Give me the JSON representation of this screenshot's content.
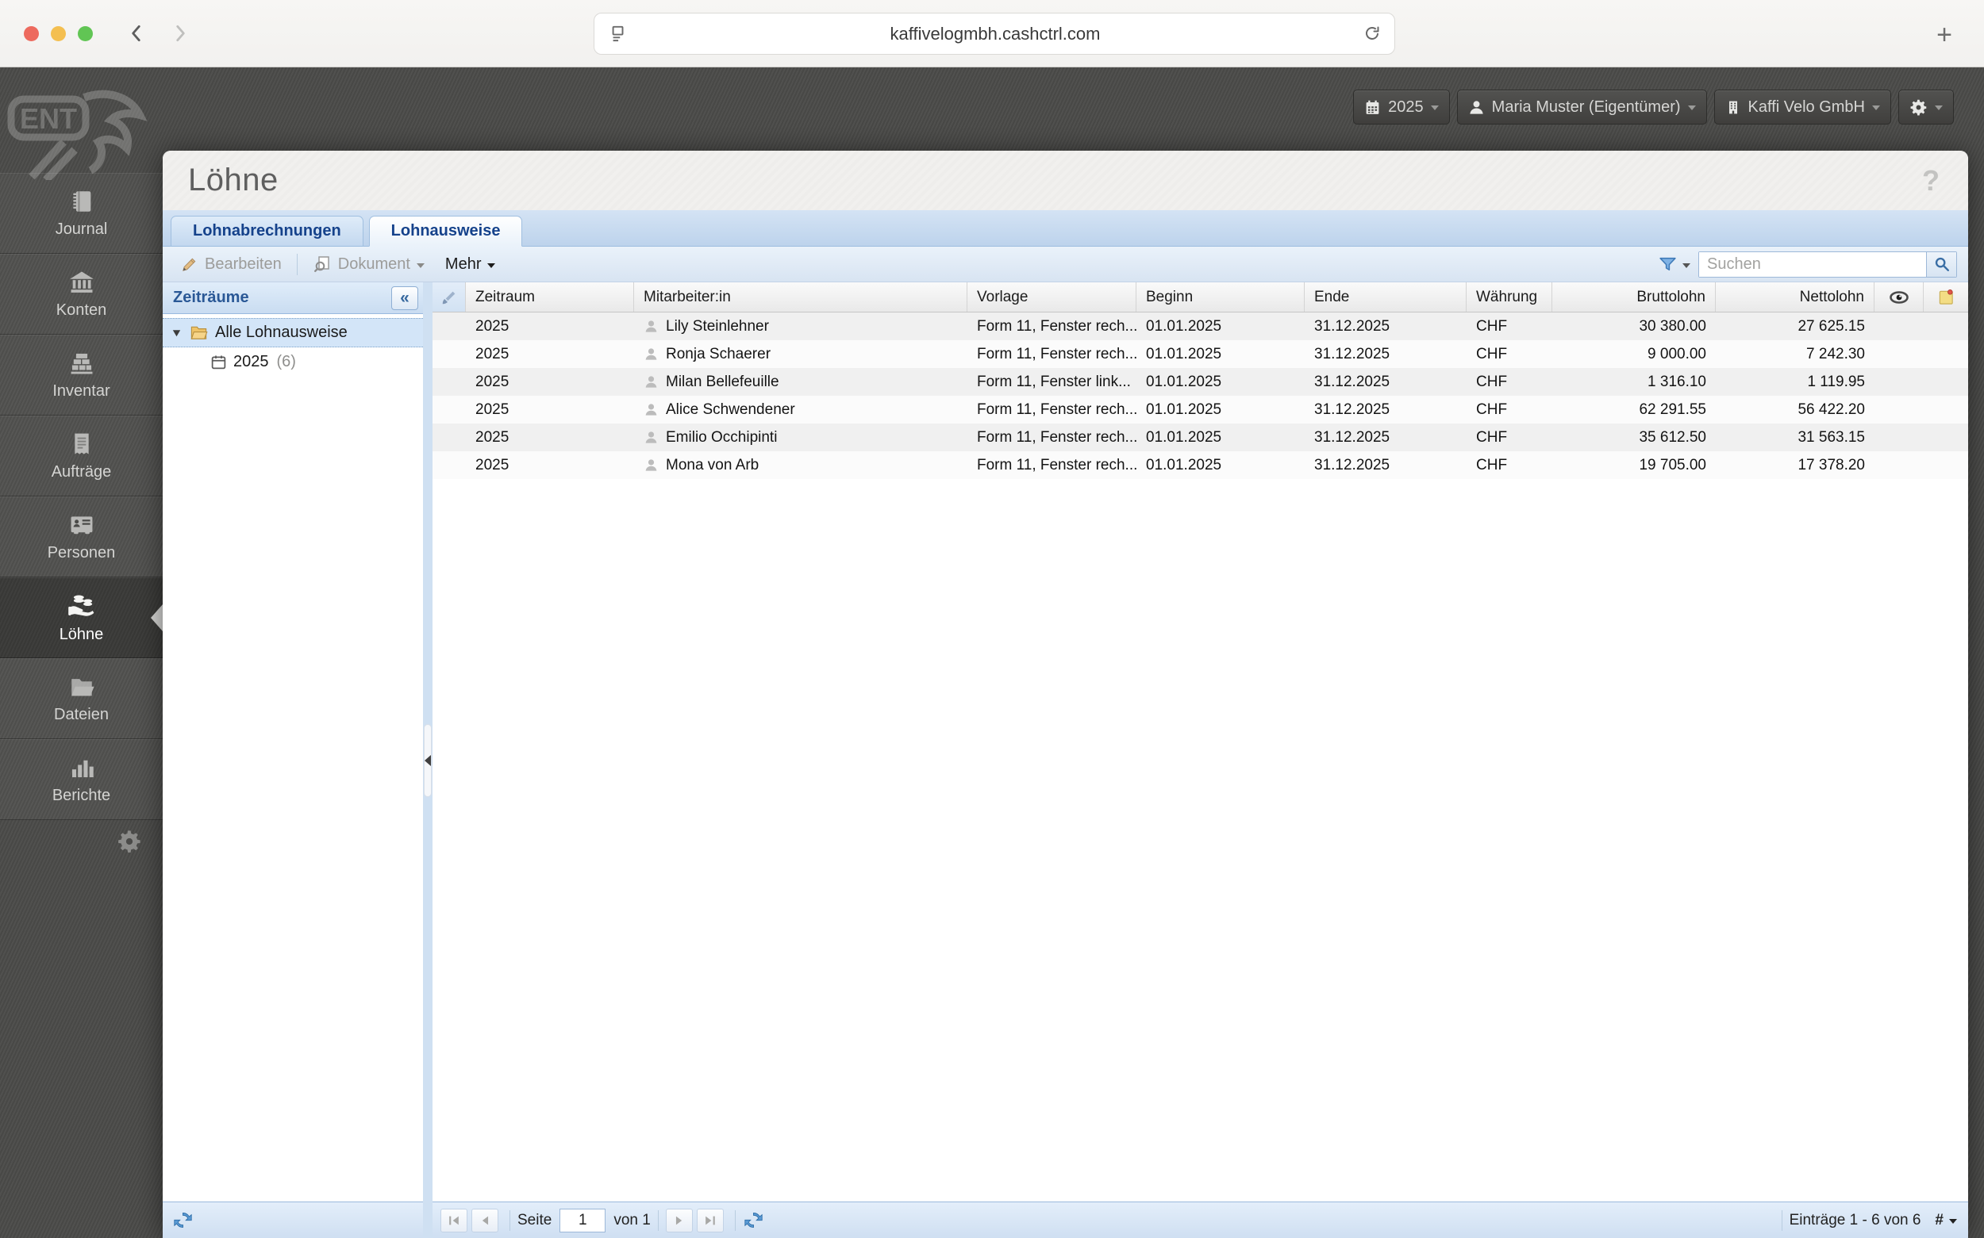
{
  "browser": {
    "url": "kaffivelogmbh.cashctrl.com"
  },
  "topbar": {
    "year": "2025",
    "user": "Maria Muster (Eigentümer)",
    "company": "Kaffi Velo GmbH"
  },
  "sidebar": {
    "logo": "ENT",
    "items": [
      {
        "label": "Journal"
      },
      {
        "label": "Konten"
      },
      {
        "label": "Inventar"
      },
      {
        "label": "Aufträge"
      },
      {
        "label": "Personen"
      },
      {
        "label": "Löhne",
        "active": true
      },
      {
        "label": "Dateien"
      },
      {
        "label": "Berichte"
      }
    ]
  },
  "page": {
    "title": "Löhne",
    "help_label": "?",
    "tabs": [
      {
        "label": "Lohnabrechnungen",
        "active": false
      },
      {
        "label": "Lohnausweise",
        "active": true
      }
    ],
    "toolbar": {
      "edit_label": "Bearbeiten",
      "document_label": "Dokument",
      "more_label": "Mehr",
      "search_placeholder": "Suchen"
    }
  },
  "tree": {
    "title": "Zeiträume",
    "collapse_glyph": "«",
    "root_label": "Alle Lohnausweise",
    "children": [
      {
        "label": "2025",
        "count": "(6)"
      }
    ]
  },
  "grid": {
    "columns": {
      "zeitraum": "Zeitraum",
      "mitarbeiter": "Mitarbeiter:in",
      "vorlage": "Vorlage",
      "beginn": "Beginn",
      "ende": "Ende",
      "waehrung": "Währung",
      "brutto": "Bruttolohn",
      "netto": "Nettolohn"
    },
    "rows": [
      {
        "zeitraum": "2025",
        "mitarbeiter": "Lily Steinlehner",
        "vorlage": "Form 11, Fenster rech...",
        "beginn": "01.01.2025",
        "ende": "31.12.2025",
        "waehrung": "CHF",
        "brutto": "30 380.00",
        "netto": "27 625.15"
      },
      {
        "zeitraum": "2025",
        "mitarbeiter": "Ronja Schaerer",
        "vorlage": "Form 11, Fenster rech...",
        "beginn": "01.01.2025",
        "ende": "31.12.2025",
        "waehrung": "CHF",
        "brutto": "9 000.00",
        "netto": "7 242.30"
      },
      {
        "zeitraum": "2025",
        "mitarbeiter": "Milan Bellefeuille",
        "vorlage": "Form 11, Fenster link...",
        "beginn": "01.01.2025",
        "ende": "31.12.2025",
        "waehrung": "CHF",
        "brutto": "1 316.10",
        "netto": "1 119.95"
      },
      {
        "zeitraum": "2025",
        "mitarbeiter": "Alice Schwendener",
        "vorlage": "Form 11, Fenster rech...",
        "beginn": "01.01.2025",
        "ende": "31.12.2025",
        "waehrung": "CHF",
        "brutto": "62 291.55",
        "netto": "56 422.20"
      },
      {
        "zeitraum": "2025",
        "mitarbeiter": "Emilio Occhipinti",
        "vorlage": "Form 11, Fenster rech...",
        "beginn": "01.01.2025",
        "ende": "31.12.2025",
        "waehrung": "CHF",
        "brutto": "35 612.50",
        "netto": "31 563.15"
      },
      {
        "zeitraum": "2025",
        "mitarbeiter": "Mona von Arb",
        "vorlage": "Form 11, Fenster rech...",
        "beginn": "01.01.2025",
        "ende": "31.12.2025",
        "waehrung": "CHF",
        "brutto": "19 705.00",
        "netto": "17 378.20"
      }
    ]
  },
  "pagination": {
    "page_label": "Seite",
    "page_value": "1",
    "of_label": "von 1",
    "entries_label": "Einträge 1 - 6 von 6",
    "count_glyph": "#"
  },
  "colors": {
    "accent_blue": "#15428b",
    "selection_blue": "#d3e5f8",
    "toolbar_blue": "#eaf2fa",
    "dark_bg": "#4b4b49",
    "folder_yellow": "#efc368",
    "note_yellow": "#f3dd84",
    "pin_red": "#e05548",
    "refresh_blue": "#5b9bd5"
  }
}
